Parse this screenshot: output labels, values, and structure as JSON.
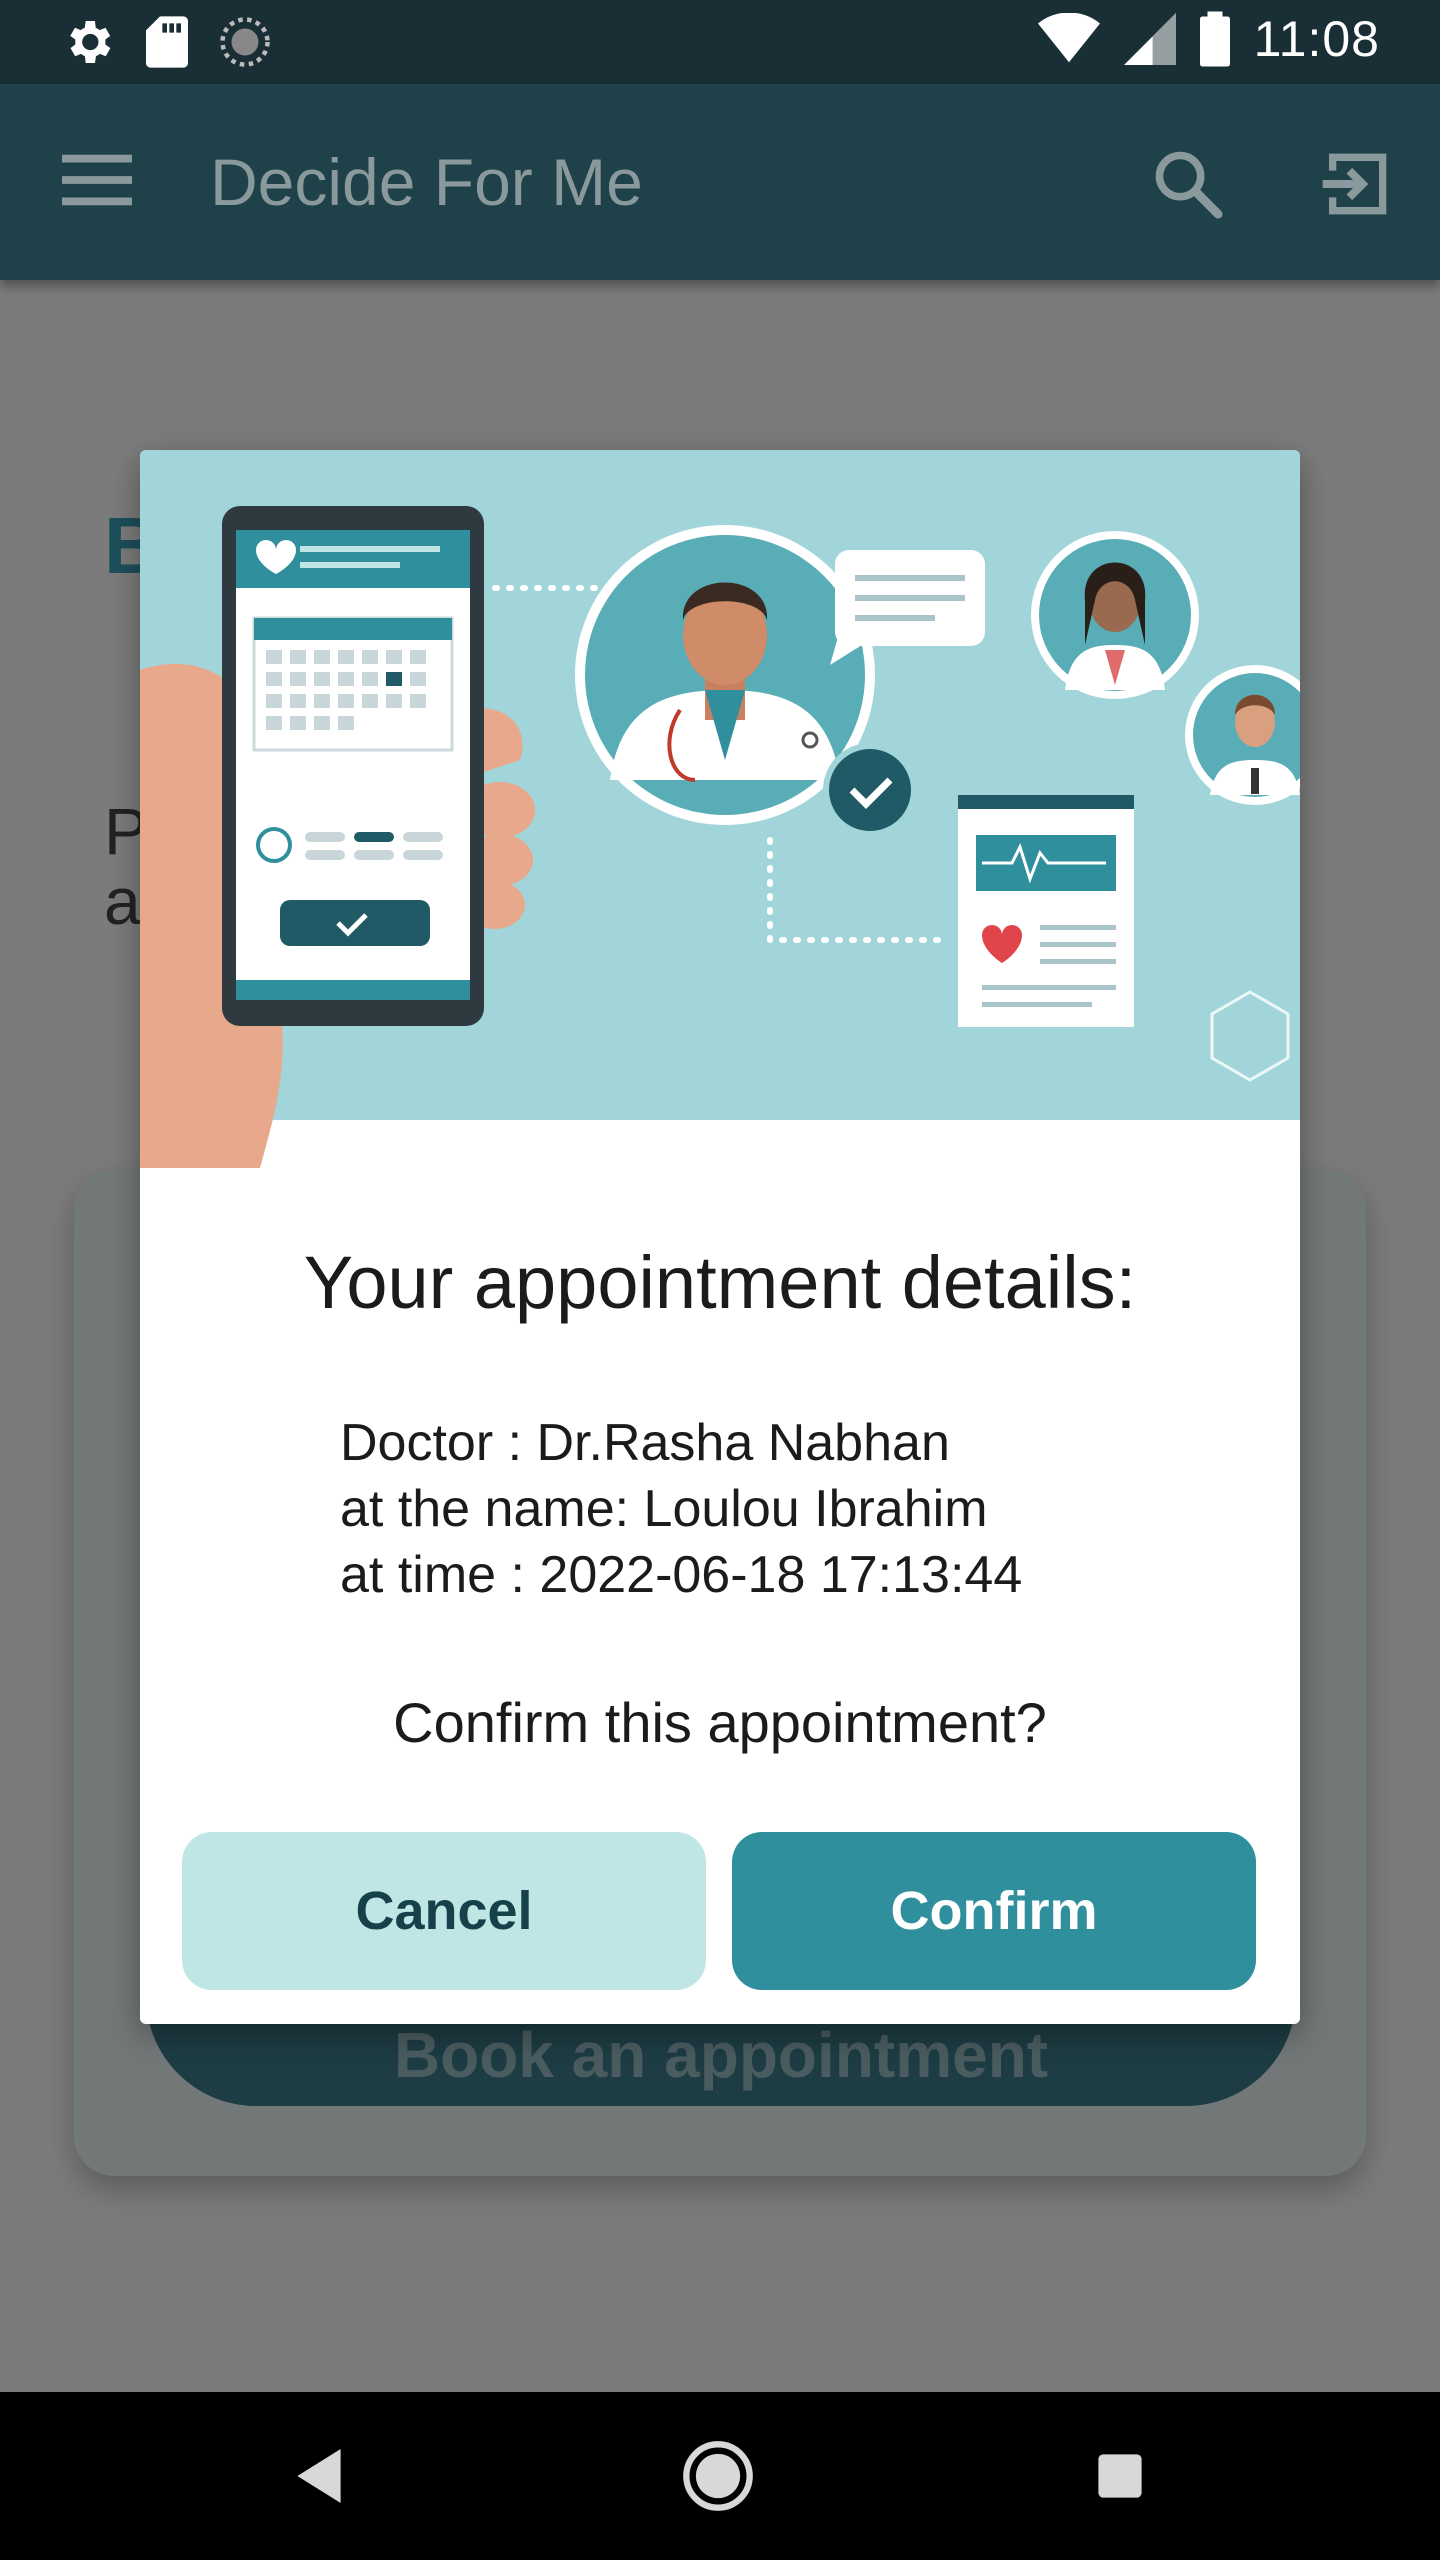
{
  "status_bar": {
    "time": "11:08",
    "icons": [
      "gear-icon",
      "sd-card-icon",
      "sync-icon",
      "wifi-icon",
      "signal-icon",
      "battery-icon"
    ]
  },
  "app_bar": {
    "title": "Decide For Me",
    "icons": [
      "menu-icon",
      "search-icon",
      "logout-icon"
    ]
  },
  "background": {
    "heading_fragment": "B",
    "text_fragment_1": "P",
    "text_fragment_2": "a",
    "book_button_label": "Book an appointment"
  },
  "dialog": {
    "title": "Your appointment details:",
    "details": [
      "Doctor : Dr.Rasha Nabhan",
      "at the name: Loulou Ibrahim",
      "at time : 2022-06-18 17:13:44"
    ],
    "question": "Confirm this appointment?",
    "cancel_label": "Cancel",
    "confirm_label": "Confirm"
  },
  "colors": {
    "app_bar": "#1f4149",
    "status_bar": "#192f35",
    "cancel_bg": "#bfe6e4",
    "confirm_bg": "#2f8f9c",
    "illustration_bg": "#a1d5d9"
  }
}
